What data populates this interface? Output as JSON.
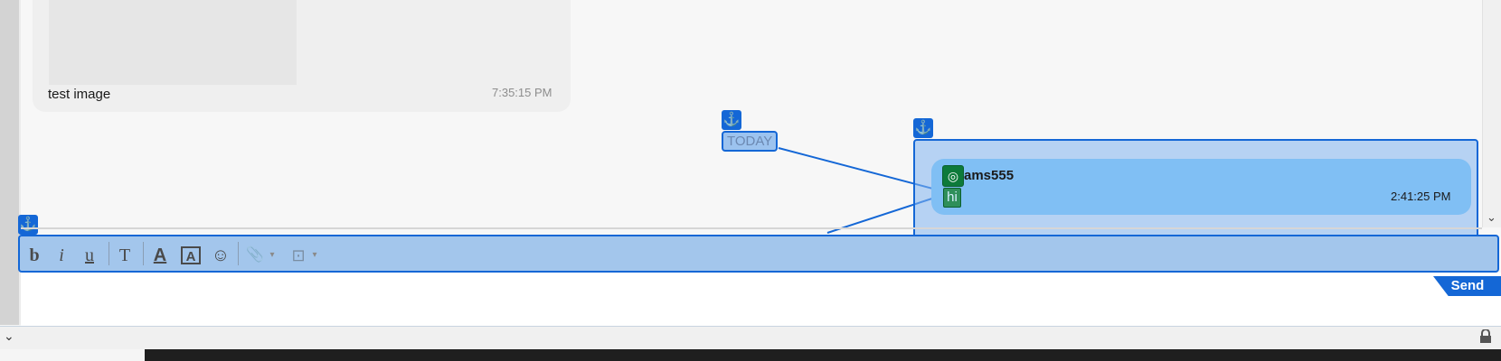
{
  "messages": {
    "image_message": {
      "caption": "test image",
      "time": "7:35:15 PM"
    },
    "date_divider": "TODAY",
    "user_message": {
      "username": "ams555",
      "text": "hi",
      "time": "2:41:25 PM"
    }
  },
  "toolbar": {
    "bold": "b",
    "italic": "i",
    "underline": "u",
    "font": "T",
    "font_color": "A",
    "highlight": "A",
    "emoji": "☺",
    "attach": "📎",
    "insert": "⊡"
  },
  "composer": {
    "send_label": "Send"
  },
  "icons": {
    "anchor": "⚓",
    "chevron_down": "⌄",
    "avatar": "◎"
  },
  "colors": {
    "accent": "#1467d6",
    "avatar_green": "#0d7a3a",
    "bubble_blue": "#80bff4"
  }
}
